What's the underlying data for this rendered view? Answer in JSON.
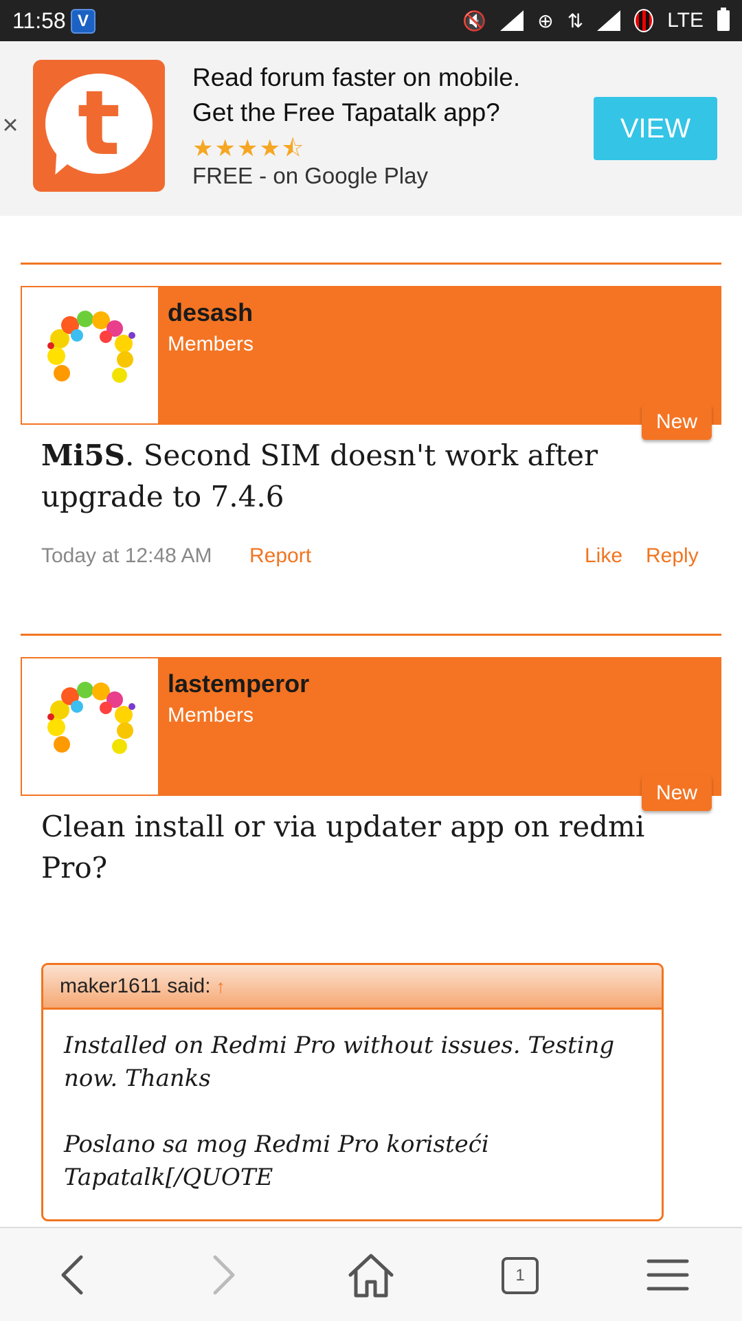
{
  "status_bar": {
    "time": "11:58",
    "app_icon_letter": "V",
    "network": "LTE"
  },
  "banner": {
    "close_symbol": "×",
    "line1": "Read forum faster on mobile.",
    "line2": "Get the Free Tapatalk app?",
    "stars": "★★★★⯪",
    "store": "FREE - on Google Play",
    "view_label": "VIEW",
    "logo_letter": "t"
  },
  "posts": [
    {
      "username": "desash",
      "role": "Members",
      "badge": "New",
      "title_bold": "Mi5S",
      "title_rest": ". Second SIM doesn't work after upgrade to 7.4.6",
      "timestamp": "Today at 12:48 AM",
      "report": "Report",
      "like": "Like",
      "reply": "Reply"
    },
    {
      "username": "lastemperor",
      "role": "Members",
      "badge": "New",
      "title": "Clean install or via updater app on redmi Pro?",
      "quote": {
        "author": "maker1611 said:",
        "arrow": "↑",
        "para1": "Installed on Redmi Pro without issues. Testing now. Thanks",
        "para2": "Poslano sa mog Redmi Pro koristeći Tapatalk[/QUOTE"
      }
    }
  ],
  "bottom_nav": {
    "tab_count": "1"
  },
  "colors": {
    "accent": "#f47423",
    "status_bar": "#222222",
    "view_button": "#33c4e6"
  }
}
